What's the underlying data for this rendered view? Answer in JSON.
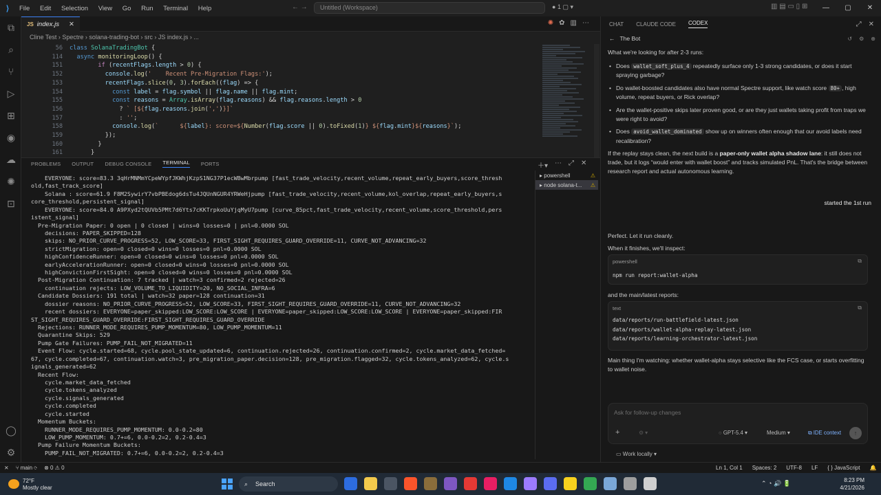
{
  "titlebar": {
    "menu": [
      "File",
      "Edit",
      "Selection",
      "View",
      "Go",
      "Run",
      "Terminal",
      "Help"
    ],
    "search": "Untitled (Workspace)",
    "counter": "1",
    "nav": "←  →"
  },
  "editor": {
    "tab_label": "index.js",
    "tab_lang": "JS",
    "breadcrumb": "Cline Test  ›  Spectre  ›  solana-trading-bot  ›  src  ›  JS  index.js  ›  ...",
    "lines": [
      {
        "n": "56",
        "html": "<span class='k'>class</span> <span class='c'>SolanaTradingBot</span> {"
      },
      {
        "n": "114",
        "html": "  <span class='k'>async</span> <span class='f'>monitoringLoop</span>() {"
      },
      {
        "n": "151",
        "html": "        <span class='p'>if</span> (<span class='v'>recentFlags</span>.<span class='v'>length</span> &gt; <span class='n'>0</span>) {"
      },
      {
        "n": "152",
        "html": "          <span class='v'>console</span>.<span class='f'>log</span>(<span class='s'>'    Recent Pre-Migration Flags:'</span>);"
      },
      {
        "n": "153",
        "html": "          <span class='v'>recentFlags</span>.<span class='f'>slice</span>(<span class='n'>0</span>, <span class='n'>3</span>).<span class='f'>forEach</span>((<span class='v'>flag</span>) =&gt; {"
      },
      {
        "n": "154",
        "html": "            <span class='k'>const</span> <span class='v'>label</span> = <span class='v'>flag</span>.<span class='v'>symbol</span> || <span class='v'>flag</span>.<span class='v'>name</span> || <span class='v'>flag</span>.<span class='v'>mint</span>;"
      },
      {
        "n": "155",
        "html": "            <span class='k'>const</span> <span class='v'>reasons</span> = <span class='c'>Array</span>.<span class='f'>isArray</span>(<span class='v'>flag</span>.<span class='v'>reasons</span>) &amp;&amp; <span class='v'>flag</span>.<span class='v'>reasons</span>.<span class='v'>length</span> &gt; <span class='n'>0</span>"
      },
      {
        "n": "156",
        "html": "              ? <span class='s'>` [${</span><span class='v'>flag</span>.<span class='v'>reasons</span>.<span class='f'>join</span>(<span class='s'>','</span>)<span class='s'>}]`</span>"
      },
      {
        "n": "157",
        "html": "              : <span class='s'>''</span>;"
      },
      {
        "n": "158",
        "html": "            <span class='v'>console</span>.<span class='f'>log</span>(<span class='s'>`      ${</span><span class='v'>label</span><span class='s'>}: score=${</span><span class='f'>Number</span>(<span class='v'>flag</span>.<span class='v'>score</span> || <span class='n'>0</span>).<span class='f'>toFixed</span>(<span class='n'>1</span>)<span class='s'>} ${</span><span class='v'>flag</span>.<span class='v'>mint</span><span class='s'>}${</span><span class='v'>reasons</span><span class='s'>}`</span>);"
      },
      {
        "n": "159",
        "html": "          });"
      },
      {
        "n": "160",
        "html": "        }"
      },
      {
        "n": "161",
        "html": "      }"
      }
    ]
  },
  "panel": {
    "tabs": [
      "PROBLEMS",
      "OUTPUT",
      "DEBUG CONSOLE",
      "TERMINAL",
      "PORTS"
    ],
    "active_tab": "TERMINAL",
    "terminals": [
      {
        "label": "powershell"
      },
      {
        "label": "node  solana-t..."
      }
    ],
    "terminal_lines": [
      "    EVERYONE: score=83.3 3qHrMNMmYCpeWYpfJKWhjKzpS1NG37P1ecWBwMbrpump [fast_trade_velocity,recent_volume,repeat_early_buyers,score_thresh",
      "old,fast_track_score]",
      "    Solana : score=61.9 F8M2SywirY7vbPBEdog6dsTu4JQUnNGUR4YRWeHjpump [fast_trade_velocity,recent_volume,kol_overlap,repeat_early_buyers,s",
      "core_threshold,persistent_signal]",
      "    EVERYONE: score=84.0 A9PXyd2tQUVb5PMt7d6Yts7cKKTrpkoUuYjqMyU7pump [curve_85pct,fast_trade_velocity,recent_volume,score_threshold,pers",
      "istent_signal]",
      "  Pre-Migration Paper: 0 open | 0 closed | wins=0 losses=0 | pnl=0.0000 SOL",
      "    decisions: PAPER_SKIPPED=128",
      "    skips: NO_PRIOR_CURVE_PROGRESS=52, LOW_SCORE=33, FIRST_SIGHT_REQUIRES_GUARD_OVERRIDE=11, CURVE_NOT_ADVANCING=32",
      "    strictMigration: open=0 closed=0 wins=0 losses=0 pnl=0.0000 SOL",
      "    highConfidenceRunner: open=0 closed=0 wins=0 losses=0 pnl=0.0000 SOL",
      "    earlyAccelerationRunner: open=0 closed=0 wins=0 losses=0 pnl=0.0000 SOL",
      "    highConvictionFirstSight: open=0 closed=0 wins=0 losses=0 pnl=0.0000 SOL",
      "  Post-Migration Continuation: 7 tracked | watch=3 confirmed=2 rejected=26",
      "    continuation rejects: LOW_VOLUME_TO_LIQUIDITY=20, NO_SOCIAL_INFRA=6",
      "  Candidate Dossiers: 191 total | watch=32 paper=128 continuation=31",
      "    dossier reasons: NO_PRIOR_CURVE_PROGRESS=52, LOW_SCORE=33, FIRST_SIGHT_REQUIRES_GUARD_OVERRIDE=11, CURVE_NOT_ADVANCING=32",
      "    recent dossiers: EVERYONE=paper_skipped:LOW_SCORE:LOW_SCORE | EVERYONE=paper_skipped:LOW_SCORE:LOW_SCORE | EVERYONE=paper_skipped:FIR",
      "ST_SIGHT_REQUIRES_GUARD_OVERRIDE:FIRST_SIGHT_REQUIRES_GUARD_OVERRIDE",
      "  Rejections: RUNNER_MODE_REQUIRES_PUMP_MOMENTUM=80, LOW_PUMP_MOMENTUM=11",
      "  Quarantine Skips: 529",
      "  Pump Gate Failures: PUMP_FAIL_NOT_MIGRATED=11",
      "  Event Flow: cycle.started=68, cycle.pool_state_updated=6, continuation.rejected=26, continuation.confirmed=2, cycle.market_data_fetched=",
      "67, cycle.completed=67, continuation.watch=3, pre_migration_paper.decision=128, pre_migration.flagged=32, cycle.tokens_analyzed=62, cycle.s",
      "ignals_generated=62",
      "  Recent Flow:",
      "    cycle.market_data_fetched",
      "    cycle.tokens_analyzed",
      "    cycle.signals_generated",
      "    cycle.completed",
      "    cycle.started",
      "  Momentum Buckets:",
      "    RUNNER_MODE_REQUIRES_PUMP_MOMENTUM: 0.0-0.2=80",
      "    LOW_PUMP_MOMENTUM: 0.7+=6, 0.0-0.2=2, 0.2-0.4=3",
      "  Pump Failure Momentum Buckets:",
      "    PUMP_FAIL_NOT_MIGRATED: 0.7+=6, 0.0-0.2=2, 0.2-0.4=3"
    ]
  },
  "chat": {
    "tabs": [
      "CHAT",
      "CLAUDE CODE",
      "CODEX"
    ],
    "active_tab": "CODEX",
    "thread_title": "The Bot",
    "intro": "What we're looking for after 2-3 runs:",
    "bullets": [
      {
        "pre": "Does ",
        "code": "wallet_soft_plus_4",
        "post": " repeatedly surface only 1-3 strong candidates, or does it start spraying garbage?"
      },
      {
        "pre": "Do wallet-boosted candidates also have normal Spectre support, like watch score ",
        "code": "80+",
        "post": ", high volume, repeat buyers, or Rick overlap?"
      },
      {
        "pre": "Are the wallet-positive skips later proven good, or are they just wallets taking profit from traps we were right to avoid?",
        "code": "",
        "post": ""
      },
      {
        "pre": "Does ",
        "code": "avoid_wallet_dominated",
        "post": " show up on winners often enough that our avoid labels need recalibration?"
      }
    ],
    "replay_pre": "If the replay stays clean, the next build is a ",
    "replay_bold": "paper-only wallet alpha shadow lane",
    "replay_post": ": it still does not trade, but it logs “would enter with wallet boost” and tracks simulated PnL. That's the bridge between research report and actual autonomous learning.",
    "user_message": "started the 1st run",
    "reply1": "Perfect. Let it run cleanly.",
    "reply2": "When it finishes, we'll inspect:",
    "block1_lang": "powershell",
    "block1_code": "npm run report:wallet-alpha",
    "reply3": "and the main/latest reports:",
    "block2_lang": "text",
    "block2_lines": [
      "data/reports/run-battlefield-latest.json",
      "data/reports/wallet-alpha-replay-latest.json",
      "data/reports/learning-orchestrator-latest.json"
    ],
    "closing": "Main thing I'm watching: whether wallet-alpha stays selective like the FCS case, or starts overfitting to wallet noise.",
    "input_placeholder": "Ask for follow-up changes",
    "model": "GPT-5.4",
    "reasoning": "Medium",
    "ide_context": "IDE context",
    "work_locally": "Work locally"
  },
  "statusbar": {
    "branch": "main",
    "problems": "0",
    "warnings": "0",
    "position": "Ln 1, Col 1",
    "spaces": "Spaces: 2",
    "encoding": "UTF-8",
    "eol": "LF",
    "language": "JavaScript"
  },
  "taskbar": {
    "temp": "72°F",
    "weather": "Mostly clear",
    "search": "Search",
    "time": "8:23 PM",
    "date": "4/21/2026",
    "app_colors": [
      "#2d6cdf",
      "#f2c94c",
      "#4b5563",
      "#fb542b",
      "#8a6d3b",
      "#7e57c2",
      "#e53935",
      "#e91e63",
      "#1e88e5",
      "#9c7bff",
      "#5b6cf0",
      "#f7d11e",
      "#34a853",
      "#7aa7d8",
      "#9e9e9e",
      "#cfcfcf"
    ]
  }
}
